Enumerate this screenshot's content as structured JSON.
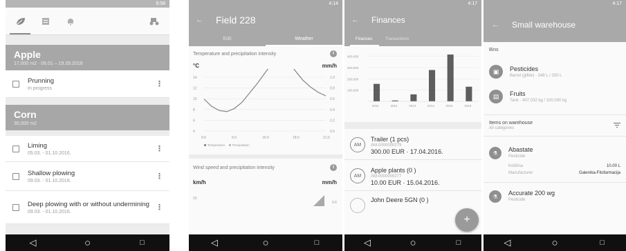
{
  "status": {
    "p1_time": "9:58",
    "p2_time": "4:14",
    "p3_time": "4:17",
    "p4_time": "4:17"
  },
  "p1": {
    "groups": [
      {
        "title": "Apple",
        "subtitle": "17,000 m2 · 06.01 – 19.09.2016",
        "tasks": [
          {
            "name": "Prunning",
            "sub": "In progress"
          }
        ]
      },
      {
        "title": "Corn",
        "subtitle": "35,000 m2",
        "tasks": [
          {
            "name": "Liming",
            "sub": "05.03. - 01.10.2016."
          },
          {
            "name": "Shallow plowing",
            "sub": "09.03. - 01.10.2016."
          },
          {
            "name": "Deep plowing with or without undermining",
            "sub": "09.03. - 01.10.2016."
          }
        ]
      }
    ],
    "icons": {
      "tab1": "leaf-icon",
      "tab2": "notes-icon",
      "tab3": "bell-icon",
      "tab4": "tractor-icon"
    }
  },
  "p2": {
    "title": "Field 228",
    "tabs": [
      "Edit",
      "Weather"
    ],
    "card1": {
      "title": "Temperature and precipitation intensity",
      "left_unit": "°C",
      "right_unit": "mm/h",
      "legend": [
        "Temperature",
        "Precipitation"
      ]
    },
    "card2": {
      "title": "Wind speed and precipitation intensity",
      "left_unit": "km/h",
      "right_unit": "mm/h"
    }
  },
  "p3": {
    "title": "Finances",
    "tabs": [
      "Finances",
      "Transactions"
    ],
    "transactions": [
      {
        "initials": "AM",
        "name": "Trailer (1 pcs)",
        "id": "AM-0000000279",
        "amount": "300.00 EUR  ·  17.04.2016."
      },
      {
        "initials": "AM",
        "name": "Apple plants (0 )",
        "id": "AM-0000000277",
        "amount": "10.00 EUR  ·  15.04.2016."
      },
      {
        "initials": "",
        "name": "John Deere 5GN (0 )",
        "id": "",
        "amount": ""
      }
    ],
    "fab": "+"
  },
  "p4": {
    "title": "Small warehouse",
    "bins_label": "Bins",
    "bins": [
      {
        "name": "Pesticides",
        "sub": "Barrel (giftiw) · 348 L / 200 L"
      },
      {
        "name": "Fruits",
        "sub": "Tank · 407,032 kg / 100,000 kg"
      }
    ],
    "items_label": "Items on warehouse",
    "items_sub": "All categories",
    "items": [
      {
        "name": "Abastate",
        "sub": "Pesticide",
        "k1": "Količina",
        "v1": "10.00 L",
        "k2": "Manufacturer",
        "v2": "Galenika-Fitofarmacija"
      },
      {
        "name": "Accurate 200 wg",
        "sub": "Pesticide",
        "k1": "",
        "v1": "",
        "k2": "",
        "v2": ""
      }
    ]
  },
  "chart_data": [
    {
      "type": "line",
      "title": "Temperature and precipitation intensity",
      "x": [
        0,
        12,
        24,
        36,
        48
      ],
      "xlabels": [
        "9:0",
        "6:0",
        "15:0",
        "18:0",
        "21:0"
      ],
      "series": [
        {
          "name": "Temperature",
          "x": [
            0,
            3,
            6,
            9,
            12,
            15,
            18,
            21,
            24,
            27,
            30,
            33,
            36,
            39,
            42,
            45,
            48
          ],
          "values": [
            9.6,
            8.2,
            7.4,
            7.2,
            7.8,
            9.0,
            10.8,
            12.6,
            14.6,
            16.6,
            17.8,
            17.0,
            15.0,
            13.2,
            11.9,
            10.9,
            10.2
          ]
        },
        {
          "name": "Precipitation",
          "values": [
            0,
            0,
            0,
            0,
            0
          ]
        }
      ],
      "ylim": [
        0,
        20
      ],
      "yticks_left": [
        14,
        12,
        10,
        8,
        6,
        4
      ],
      "yticks_right": [
        1.0,
        0.8,
        0.6,
        0.4,
        0.2,
        0.0
      ],
      "ylabel_left": "°C",
      "ylabel_right": "mm/h",
      "grid": true,
      "legend": "bottom-left"
    },
    {
      "type": "bar",
      "categories": [
        "2011",
        "2012",
        "2013",
        "2014",
        "2015",
        "2016"
      ],
      "values": [
        155000,
        8000,
        62000,
        278000,
        415000,
        130000
      ],
      "yticks": [
        "400,000",
        "300,000",
        "200,000",
        "100,000"
      ],
      "ylim": [
        0,
        440000
      ],
      "grid": true
    }
  ]
}
